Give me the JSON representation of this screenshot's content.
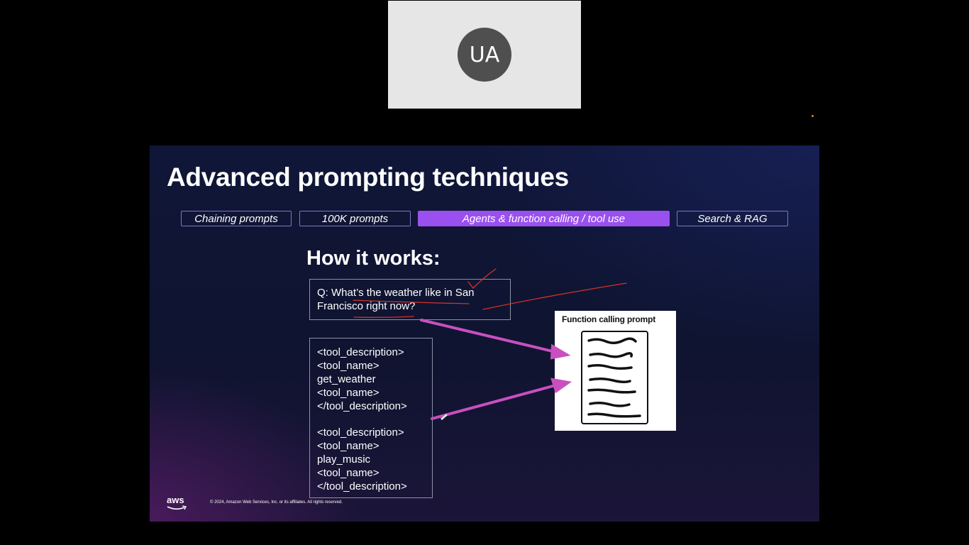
{
  "participant": {
    "initials": "UA"
  },
  "slide": {
    "title": "Advanced prompting techniques",
    "tabs": [
      {
        "label": "Chaining prompts",
        "active": false
      },
      {
        "label": "100K prompts",
        "active": false
      },
      {
        "label": "Agents & function calling / tool use",
        "active": true
      },
      {
        "label": "Search & RAG",
        "active": false
      }
    ],
    "section_heading": "How it works:",
    "question": {
      "line1": "Q: What’s the weather like in San",
      "line2": "Francisco right now?"
    },
    "tools": [
      [
        "<tool_description>",
        "<tool_name>",
        "get_weather",
        "<tool_name>",
        "</tool_description>"
      ],
      [
        "<tool_description>",
        "<tool_name>",
        "play_music",
        "<tool_name>",
        "</tool_description>"
      ]
    ],
    "function_panel": {
      "title": "Function calling prompt"
    },
    "footer": {
      "logo_text": "aws",
      "copyright": "© 2024, Amazon Web Services, Inc. or its affiliates. All rights reserved."
    }
  },
  "colors": {
    "accent_purple": "#9a50ee",
    "arrow_magenta": "#c94fc0",
    "annotation_red": "#d2322a",
    "tab_border": "#7d77c4"
  }
}
